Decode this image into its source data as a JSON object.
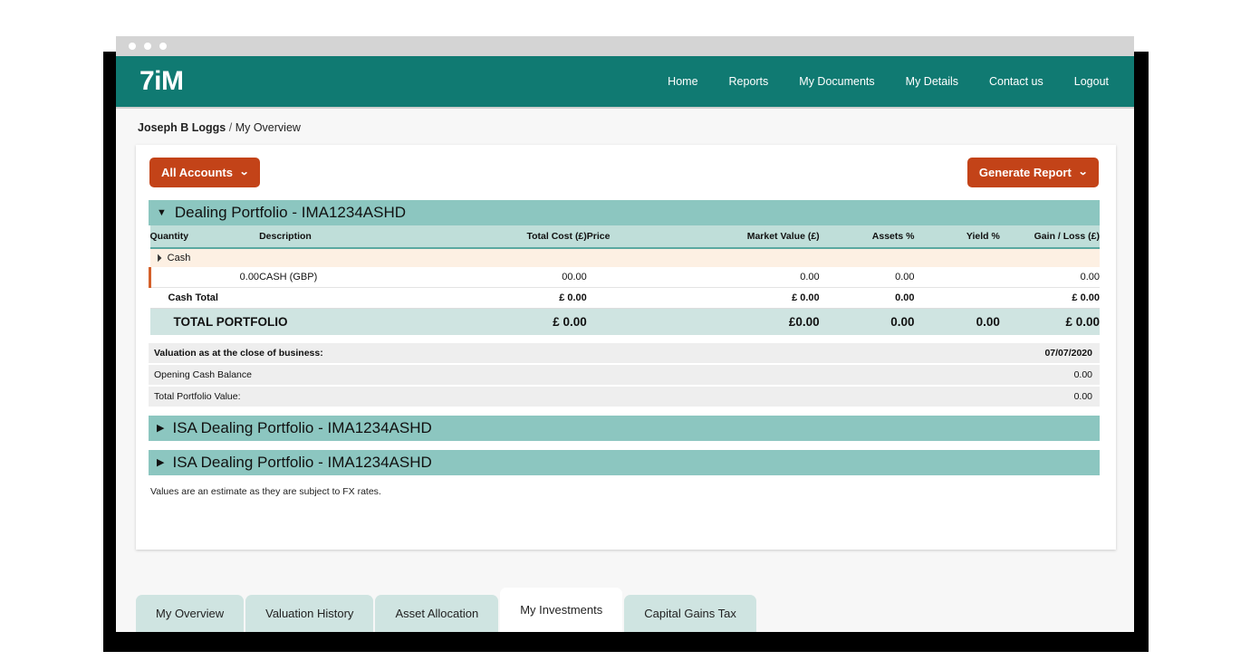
{
  "window": {
    "dots": [
      "close-dot",
      "minimize-dot",
      "maximize-dot"
    ]
  },
  "header": {
    "brand": "7iM",
    "nav": [
      {
        "label": "Home"
      },
      {
        "label": "Reports"
      },
      {
        "label": "My Documents"
      },
      {
        "label": "My Details"
      },
      {
        "label": "Contact us"
      },
      {
        "label": "Logout"
      }
    ]
  },
  "breadcrumb": {
    "user": "Joseph B Loggs",
    "separator": "/",
    "page": "My Overview"
  },
  "toolbar": {
    "accounts_label": "All Accounts",
    "accounts_caret": "⌄",
    "report_label": "Generate Report",
    "report_caret": "⌄"
  },
  "portfolio": {
    "title": "Dealing Portfolio - IMA1234ASHD",
    "expand_icon": "▼",
    "columns": [
      {
        "label": "Quantity"
      },
      {
        "label": "Description"
      },
      {
        "label": "Total Cost (£)"
      },
      {
        "label": "Price"
      },
      {
        "label": "Market Value (£)"
      },
      {
        "label": "Assets %"
      },
      {
        "label": "Yield %"
      },
      {
        "label": "Gain / Loss (£)"
      }
    ],
    "group": {
      "label": "Cash",
      "tri": "◢"
    },
    "rows": [
      {
        "quantity": "0.00",
        "description": "CASH (GBP)",
        "total_cost": "00.00",
        "price": "",
        "market_value": "0.00",
        "assets_pct": "0.00",
        "yield_pct": "",
        "gain_loss": "0.00"
      }
    ],
    "subtotal": {
      "label": "Cash Total",
      "total_cost": "£ 0.00",
      "price": "",
      "market_value": "£ 0.00",
      "assets_pct": "0.00",
      "yield_pct": "",
      "gain_loss": "£ 0.00"
    },
    "total": {
      "label": "TOTAL PORTFOLIO",
      "total_cost": "£ 0.00",
      "price": "",
      "market_value": "£0.00",
      "assets_pct": "0.00",
      "yield_pct": "0.00",
      "gain_loss": "£ 0.00"
    },
    "summary": [
      {
        "label": "Valuation as at the close of business:",
        "value": "07/07/2020",
        "bold": true
      },
      {
        "label": "Opening Cash Balance",
        "value": "0.00",
        "bold": false
      },
      {
        "label": "Total Portfolio Value:",
        "value": "0.00",
        "bold": false
      }
    ]
  },
  "collapsed_sections": [
    {
      "title": "ISA Dealing Portfolio - IMA1234ASHD",
      "icon": "▶"
    },
    {
      "title": "ISA Dealing Portfolio - IMA1234ASHD",
      "icon": "▶"
    }
  ],
  "fx_note": "Values are an estimate as they are subject to FX rates.",
  "tabs": [
    {
      "label": "My Overview",
      "active": false
    },
    {
      "label": "Valuation History",
      "active": false
    },
    {
      "label": "Asset Allocation",
      "active": false
    },
    {
      "label": "My Investments",
      "active": true
    },
    {
      "label": "Capital Gains Tax",
      "active": false
    }
  ],
  "colors": {
    "brand_teal": "#107a72",
    "accent_orange": "#c34318",
    "section_teal": "#8cc6c0",
    "table_header_teal": "#bfded9",
    "total_row_teal": "#cfe4e1",
    "group_row_cream": "#fdf0e3",
    "marker_orange": "#d4602a"
  }
}
